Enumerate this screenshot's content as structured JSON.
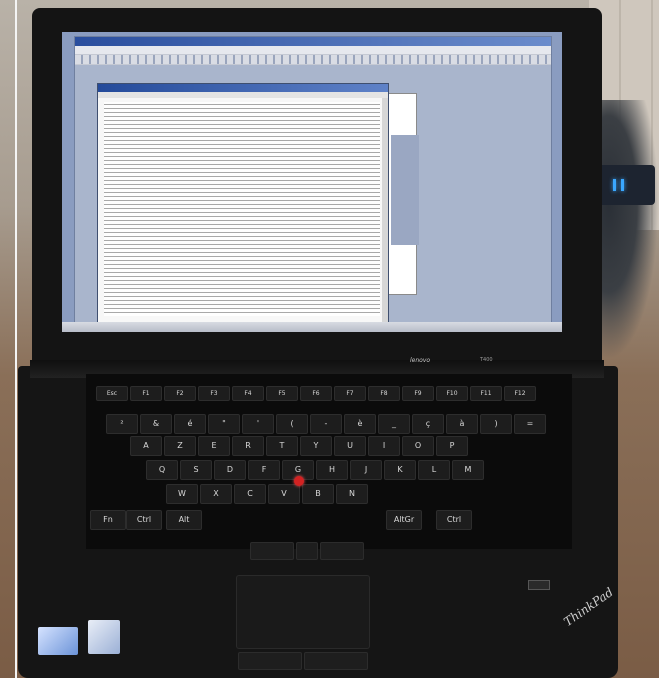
{
  "scene": {
    "description_icons": [
      "laptop",
      "keyboard",
      "touchpad",
      "trackpoint"
    ],
    "colors": {
      "lid": "#141414",
      "screen_bg": "#8a9cc0",
      "trackpoint": "#d22222",
      "desk": "#7a5c45"
    }
  },
  "laptop": {
    "brand": "lenovo",
    "model": "T400",
    "logo": "ThinkPad"
  },
  "keyboard": {
    "rows": [
      [
        "Esc",
        "F1",
        "F2",
        "F3",
        "F4",
        "F5",
        "F6",
        "F7",
        "F8",
        "F9",
        "F10",
        "F11",
        "F12"
      ],
      [
        "²",
        "&",
        "é",
        "\"",
        "'",
        "(",
        "-",
        "è",
        "_",
        "ç",
        "à",
        ")",
        "="
      ],
      [
        "A",
        "Z",
        "E",
        "R",
        "T",
        "Y",
        "U",
        "I",
        "O",
        "P"
      ],
      [
        "Q",
        "S",
        "D",
        "F",
        "G",
        "H",
        "J",
        "K",
        "L",
        "M"
      ],
      [
        "W",
        "X",
        "C",
        "V",
        "B",
        "N"
      ],
      [
        "Fn",
        "Ctrl",
        "Alt",
        "AltGr",
        "Ctrl"
      ]
    ]
  }
}
